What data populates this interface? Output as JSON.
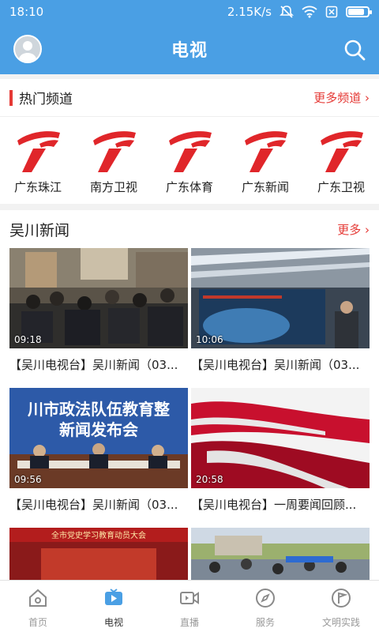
{
  "status": {
    "time": "18:10",
    "speed": "2.15K/s",
    "battery_level": 0.85
  },
  "header": {
    "title": "电视",
    "avatar_icon": "avatar-icon",
    "search_icon": "search-icon"
  },
  "hot_channels": {
    "title": "热门频道",
    "more": "更多频道 ›",
    "items": [
      {
        "name": "广东珠江"
      },
      {
        "name": "南方卫视"
      },
      {
        "name": "广东体育"
      },
      {
        "name": "广东新闻"
      },
      {
        "name": "广东卫视"
      }
    ]
  },
  "news": {
    "title": "吴川新闻",
    "more": "更多 ›",
    "videos": [
      {
        "title": "【吴川电视台】吴川新闻（03...",
        "duration": "09:18"
      },
      {
        "title": "【吴川电视台】吴川新闻（03...",
        "duration": "10:06"
      },
      {
        "title": "【吴川电视台】吴川新闻（03...",
        "duration": "09:56",
        "banner": "川市政法队伍教育整",
        "subtitle": "新闻发布会"
      },
      {
        "title": "【吴川电视台】一周要闻回顾...",
        "duration": "20:58"
      },
      {
        "banner": "全市党史学习教育动员大会"
      },
      {}
    ]
  },
  "tabs": [
    {
      "label": "首页",
      "icon": "home-icon"
    },
    {
      "label": "电视",
      "icon": "tv-icon",
      "active": true
    },
    {
      "label": "直播",
      "icon": "live-camera-icon"
    },
    {
      "label": "服务",
      "icon": "compass-icon"
    },
    {
      "label": "文明实践",
      "icon": "flag-icon"
    }
  ],
  "colors": {
    "primary": "#4a9fe4",
    "accent": "#e53935"
  }
}
